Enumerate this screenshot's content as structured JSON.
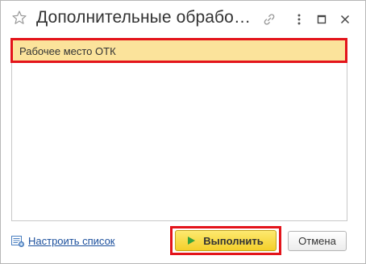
{
  "window": {
    "title": "Дополнительные обрабо…"
  },
  "titlebar": {
    "icons": [
      "star-icon",
      "link-icon",
      "more-vertical-icon",
      "maximize-icon",
      "close-icon"
    ]
  },
  "list": {
    "items": [
      {
        "label": "Рабочее место ОТК",
        "selected": true
      }
    ]
  },
  "footer": {
    "configure_label": "Настроить список",
    "execute_label": "Выполнить",
    "cancel_label": "Отмена"
  },
  "colors": {
    "selection": "#fbe39b",
    "highlight": "#e3141b",
    "primary_button": "#f4cf2a",
    "link": "#1b4f9c",
    "play": "#3aa33c"
  }
}
